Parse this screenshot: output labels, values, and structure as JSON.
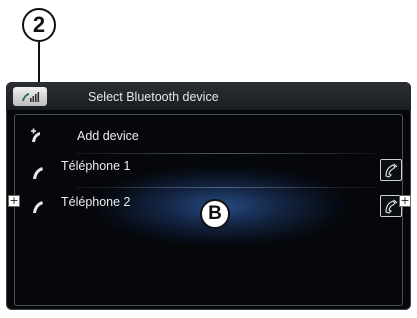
{
  "callouts": {
    "top": "2",
    "center": "B"
  },
  "header": {
    "title": "Select Bluetooth device"
  },
  "rows": [
    {
      "label": "Add device"
    },
    {
      "label": "Téléphone 1"
    },
    {
      "label": "Téléphone 2"
    }
  ],
  "markers": {
    "plus": "+"
  },
  "colors": {
    "background": "#05070b",
    "glow": "#2b5696",
    "text": "#ececec"
  }
}
